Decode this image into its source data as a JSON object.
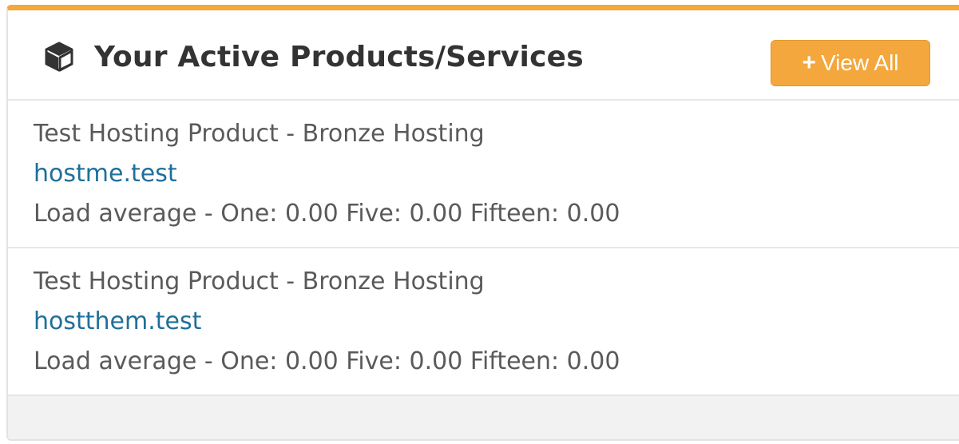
{
  "panel": {
    "title": "Your Active Products/Services",
    "title_icon": "cube-icon",
    "view_all_label": "View All",
    "view_all_icon": "plus-icon",
    "accent_color": "#f3a73d",
    "link_color": "#1f6f9a"
  },
  "items": [
    {
      "product": "Test Hosting Product - Bronze Hosting",
      "domain": "hostme.test",
      "load": "Load average - One: 0.00 Five: 0.00 Fifteen: 0.00"
    },
    {
      "product": "Test Hosting Product - Bronze Hosting",
      "domain": "hostthem.test",
      "load": "Load average - One: 0.00 Five: 0.00 Fifteen: 0.00"
    }
  ]
}
